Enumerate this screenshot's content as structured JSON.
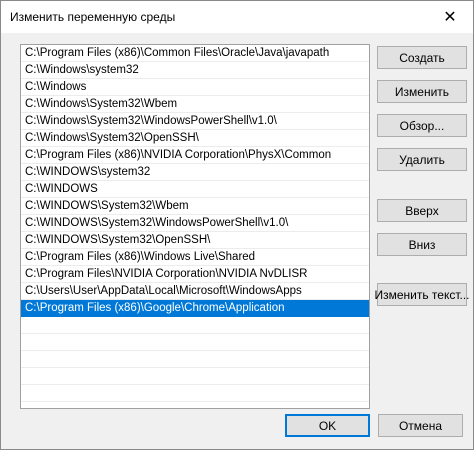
{
  "window": {
    "title": "Изменить переменную среды",
    "close_glyph": "✕"
  },
  "paths": [
    "C:\\Program Files (x86)\\Common Files\\Oracle\\Java\\javapath",
    "C:\\Windows\\system32",
    "C:\\Windows",
    "C:\\Windows\\System32\\Wbem",
    "C:\\Windows\\System32\\WindowsPowerShell\\v1.0\\",
    "C:\\Windows\\System32\\OpenSSH\\",
    "C:\\Program Files (x86)\\NVIDIA Corporation\\PhysX\\Common",
    "C:\\WINDOWS\\system32",
    "C:\\WINDOWS",
    "C:\\WINDOWS\\System32\\Wbem",
    "C:\\WINDOWS\\System32\\WindowsPowerShell\\v1.0\\",
    "C:\\WINDOWS\\System32\\OpenSSH\\",
    "C:\\Program Files (x86)\\Windows Live\\Shared",
    "C:\\Program Files\\NVIDIA Corporation\\NVIDIA NvDLISR",
    "C:\\Users\\User\\AppData\\Local\\Microsoft\\WindowsApps",
    "C:\\Program Files (x86)\\Google\\Chrome\\Application"
  ],
  "selected_index": 15,
  "buttons": {
    "create": "Создать",
    "edit": "Изменить",
    "browse": "Обзор...",
    "delete": "Удалить",
    "up": "Вверх",
    "down": "Вниз",
    "edit_text": "Изменить текст...",
    "ok": "OK",
    "cancel": "Отмена"
  },
  "colors": {
    "selection": "#0078d7",
    "dialog_bg": "#f0f0f0",
    "button_bg": "#e1e1e1"
  }
}
